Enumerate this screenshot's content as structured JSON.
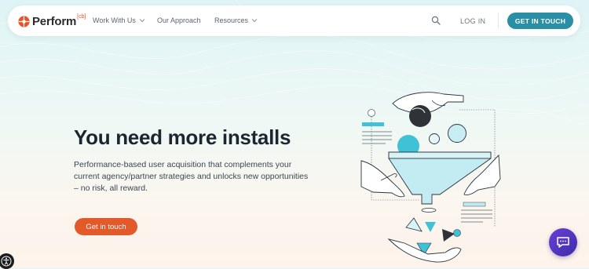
{
  "nav": {
    "logo_text": "Perform",
    "logo_sup": "[cb]",
    "items": [
      {
        "label": "Work With Us",
        "has_dropdown": true
      },
      {
        "label": "Our Approach",
        "has_dropdown": false
      },
      {
        "label": "Resources",
        "has_dropdown": true
      }
    ],
    "search_icon": "search-icon",
    "login_label": "LOG IN",
    "cta_label": "GET IN TOUCH"
  },
  "hero": {
    "headline": "You need more installs",
    "subtext_lines": [
      "Performance-based user acquisition that complements your",
      "current agency/partner strategies and unlocks new opportunities",
      "– no risk, all reward."
    ],
    "cta_label": "Get in touch"
  },
  "widgets": {
    "chat_icon": "chat-bubble-icon",
    "accessibility_icon": "accessibility-icon"
  },
  "colors": {
    "brand_teal": "#2a8fa5",
    "brand_orange": "#e25a29",
    "illustration_cyan": "#3fc1d6",
    "chat_purple": "#5a35c8"
  }
}
